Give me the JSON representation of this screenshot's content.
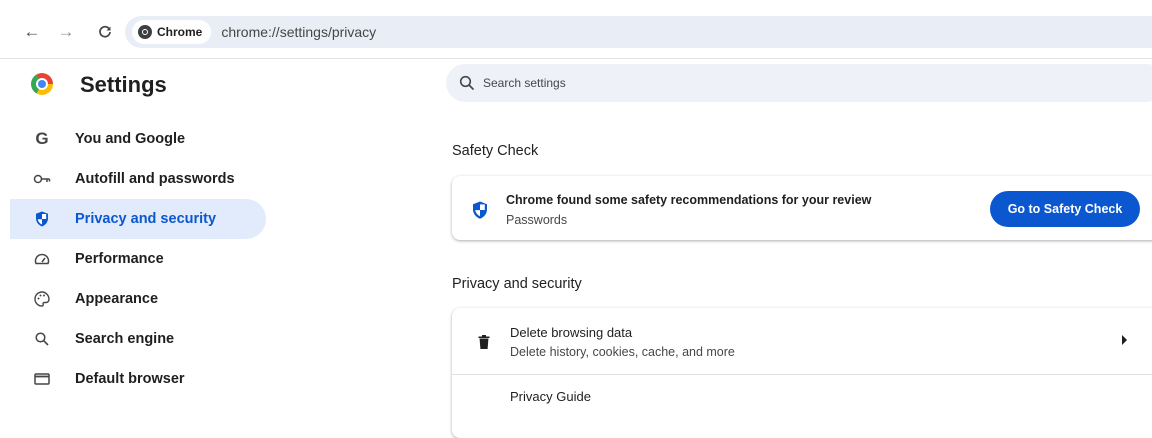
{
  "browser": {
    "back_icon": "arrow-left-icon",
    "forward_icon": "arrow-right-icon",
    "reload_icon": "reload-icon",
    "chip_label": "Chrome",
    "url": "chrome://settings/privacy"
  },
  "sidebar": {
    "title": "Settings",
    "items": [
      {
        "label": "You and Google",
        "icon": "google-g-icon",
        "active": false
      },
      {
        "label": "Autofill and passwords",
        "icon": "key-icon",
        "active": false
      },
      {
        "label": "Privacy and security",
        "icon": "shield-icon",
        "active": true
      },
      {
        "label": "Performance",
        "icon": "speedometer-icon",
        "active": false
      },
      {
        "label": "Appearance",
        "icon": "palette-icon",
        "active": false
      },
      {
        "label": "Search engine",
        "icon": "search-icon",
        "active": false
      },
      {
        "label": "Default browser",
        "icon": "browser-window-icon",
        "active": false
      }
    ]
  },
  "search": {
    "placeholder": "Search settings"
  },
  "safety_check": {
    "section_title": "Safety Check",
    "title": "Chrome found some safety recommendations for your review",
    "subtitle": "Passwords",
    "button_label": "Go to Safety Check"
  },
  "privacy": {
    "section_title": "Privacy and security",
    "rows": [
      {
        "title": "Delete browsing data",
        "subtitle": "Delete history, cookies, cache, and more"
      },
      {
        "title": "Privacy Guide"
      }
    ]
  },
  "colors": {
    "accent": "#0b57d0",
    "active_bg": "#e2ebfb",
    "omnibox_bg": "#e9eef6"
  }
}
